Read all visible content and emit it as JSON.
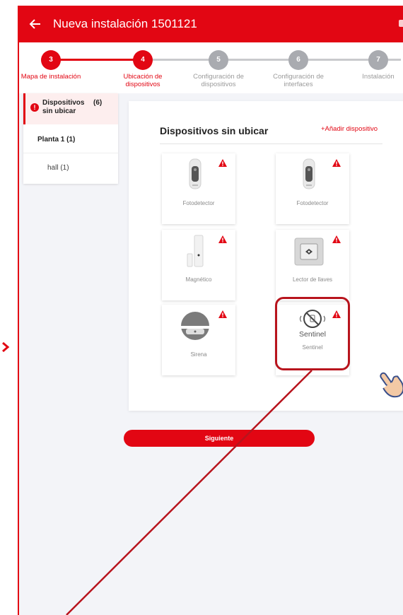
{
  "header": {
    "title": "Nueva instalación 1501121",
    "accent": "#e20613"
  },
  "stepper": {
    "steps": [
      {
        "number": "3",
        "label": "Mapa de instalación",
        "state": "active"
      },
      {
        "number": "4",
        "label": "Ubicación de dispositivos",
        "state": "active"
      },
      {
        "number": "5",
        "label": "Configuración de dispositivos",
        "state": "todo"
      },
      {
        "number": "6",
        "label": "Configuración de interfaces",
        "state": "todo"
      },
      {
        "number": "7",
        "label": "Instalación",
        "state": "todo"
      }
    ]
  },
  "sidebar": {
    "unplaced_label": "Dispositivos sin ubicar",
    "unplaced_count": "(6)",
    "floor_label": "Planta 1 (1)",
    "room_label": "hall (1)"
  },
  "panel": {
    "title": "Dispositivos sin ubicar",
    "add_label": "+Añadir dispositivo",
    "devices": [
      {
        "name": "Fotodetector",
        "icon": "photodetector-icon"
      },
      {
        "name": "Fotodetector",
        "icon": "photodetector-icon"
      },
      {
        "name": "Magnético",
        "icon": "magnetic-sensor-icon"
      },
      {
        "name": "Lector de llaves",
        "icon": "key-reader-icon"
      },
      {
        "name": "Sirena",
        "icon": "siren-icon"
      },
      {
        "name": "Sentinel",
        "icon": "sentinel-icon",
        "image_caption": "Sentinel"
      }
    ]
  },
  "footer": {
    "next_label": "Siguiente"
  }
}
